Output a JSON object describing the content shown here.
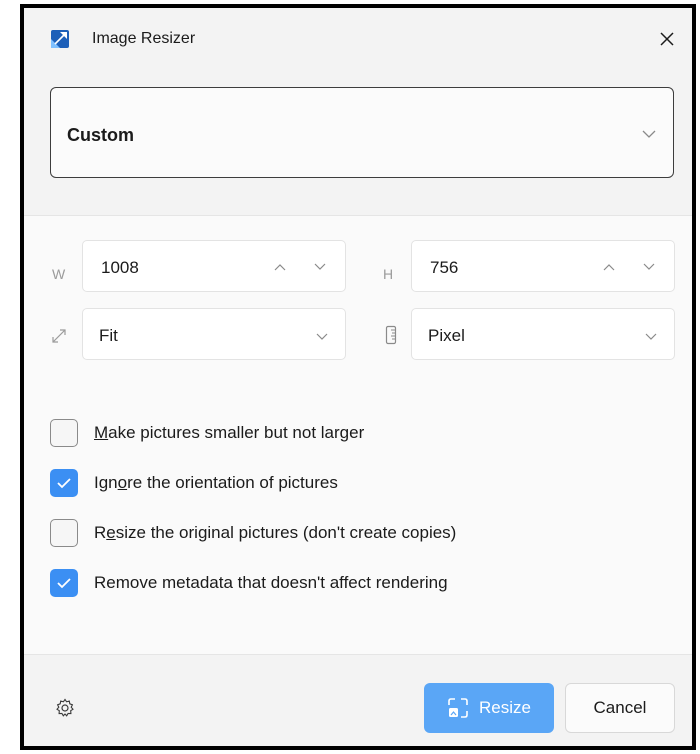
{
  "window": {
    "title": "Image Resizer",
    "app_icon": "image-resizer-app-icon",
    "close_icon": "close-icon"
  },
  "preset": {
    "selected": "Custom",
    "icon": "chevron-down-icon"
  },
  "dimensions": {
    "width": {
      "prefix": "W",
      "value": "1008"
    },
    "height": {
      "prefix": "H",
      "value": "756"
    }
  },
  "fit": {
    "selected": "Fit",
    "icon": "resize-arrow-icon"
  },
  "unit": {
    "selected": "Pixel",
    "icon": "ruler-icon"
  },
  "options": [
    {
      "pre": "",
      "accel": "M",
      "post": "ake pictures smaller but not larger",
      "checked": false
    },
    {
      "pre": "Ign",
      "accel": "o",
      "post": "re the orientation of pictures",
      "checked": true
    },
    {
      "pre": "R",
      "accel": "e",
      "post": "size the original pictures (don't create copies)",
      "checked": false
    },
    {
      "pre": "",
      "accel": "",
      "post": "Remove metadata that doesn't affect rendering",
      "checked": true
    }
  ],
  "footer": {
    "settings_icon": "gear-icon",
    "resize_label": "Resize",
    "cancel_label": "Cancel"
  },
  "colors": {
    "accent": "#3b8ff3",
    "button_primary": "#5aa6f6",
    "window_bg": "#f3f3f3"
  }
}
